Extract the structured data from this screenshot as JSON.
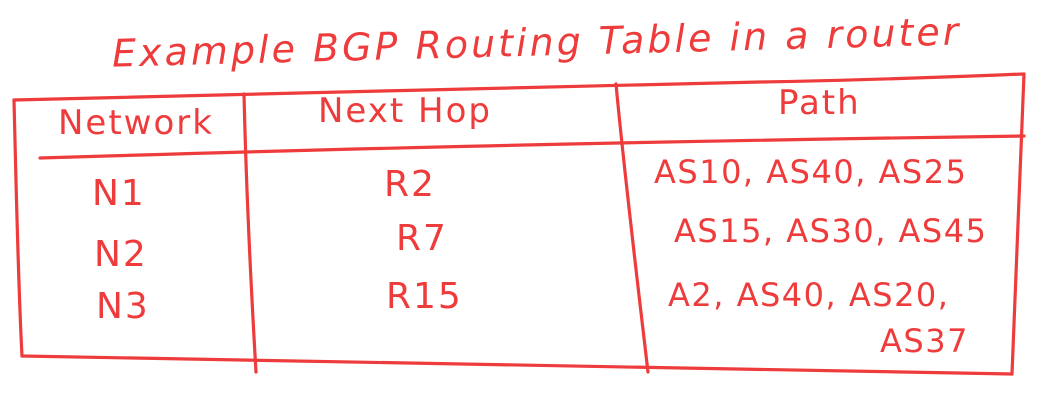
{
  "title": "Example BGP Routing Table in a router",
  "table": {
    "headers": [
      "Network",
      "Next Hop",
      "Path"
    ],
    "rows": [
      {
        "network": "N1",
        "next_hop": "R2",
        "path": "AS10, AS40, AS25"
      },
      {
        "network": "N2",
        "next_hop": "R7",
        "path": "AS15, AS30, AS45"
      },
      {
        "network": "N3",
        "next_hop": "R15",
        "path_line1": "A2, AS40, AS20,",
        "path_line2": "AS37"
      }
    ]
  },
  "colors": {
    "ink": "#ee3b3b",
    "background": "#ffffff"
  }
}
